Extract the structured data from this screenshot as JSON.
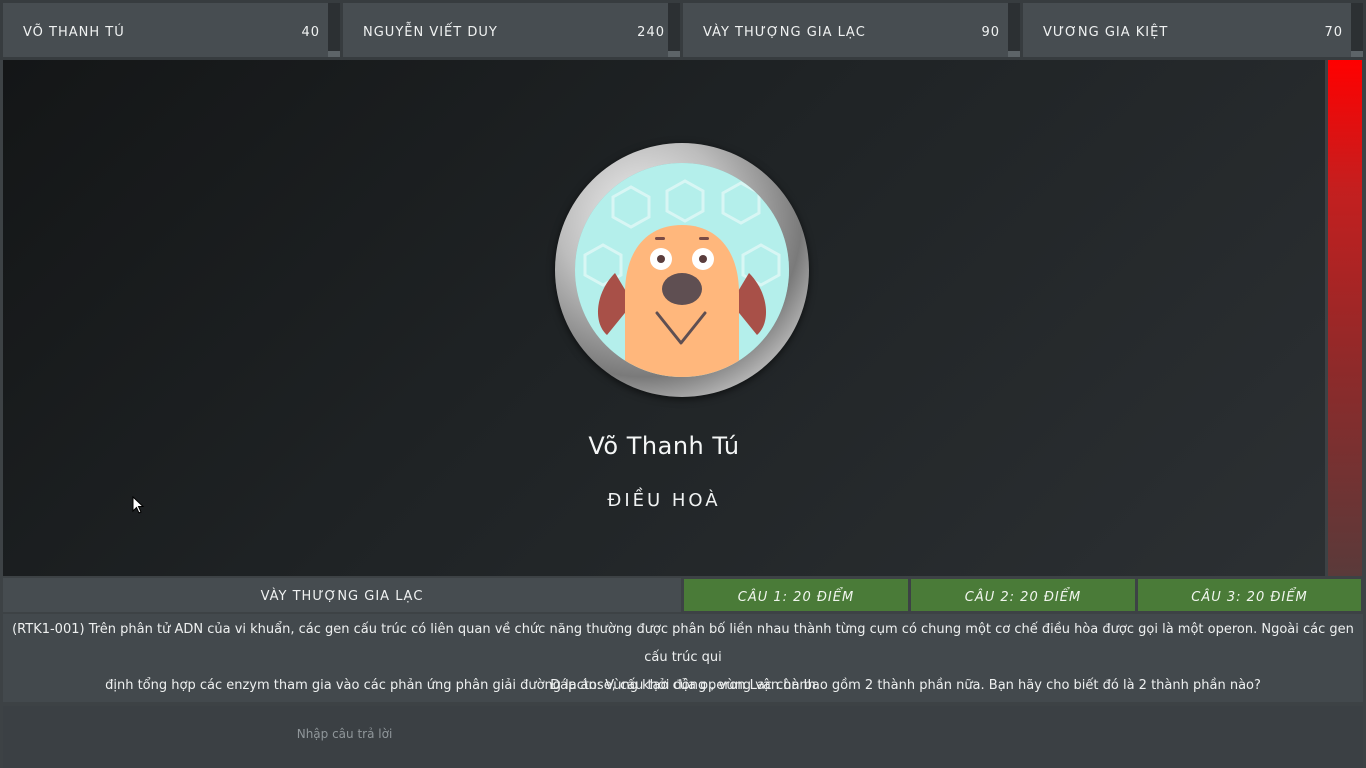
{
  "players": [
    {
      "name": "VÕ THANH TÚ",
      "score": "40"
    },
    {
      "name": "NGUYỄN VIẾT DUY",
      "score": "240"
    },
    {
      "name": "VÀY THƯỢNG GIA LẠC",
      "score": "90"
    },
    {
      "name": "VƯƠNG GIA KIỆT",
      "score": "70"
    }
  ],
  "stage": {
    "player_name": "Võ Thanh Tú",
    "status": "ĐIỀU HOÀ",
    "avatar_icon": "dog-avatar-icon"
  },
  "timer": {
    "remaining_fraction": 1.0,
    "color": "#ff0000"
  },
  "question_bar": {
    "turn_player": "VÀY THƯỢNG GIA LẠC",
    "buttons": [
      "CÂU 1: 20 ĐIỂM",
      "CÂU 2: 20 ĐIỂM",
      "CÂU 3: 20 ĐIỂM"
    ],
    "button_color": "#4a7b38"
  },
  "question": {
    "line1": "(RTK1-001) Trên phân tử ADN của vi khuẩn, các gen cấu trúc có liên quan về chức năng thường được phân bố liền nhau thành từng cụm có chung một cơ chế điều hòa được gọi là một operon. Ngoài các gen cấu trúc qui",
    "line2": "định tổng hợp các enzym tham gia vào các phản ứng phân giải đường lactose, cấu tạo của operon Lac còn bao gồm 2 thành phần nữa. Bạn hãy cho biết đó là 2 thành phần nào?",
    "answer": "Đáp án: Vùng khởi động , vùng vận hành"
  },
  "answer_input": {
    "placeholder": "Nhập câu trả lời",
    "value": ""
  }
}
